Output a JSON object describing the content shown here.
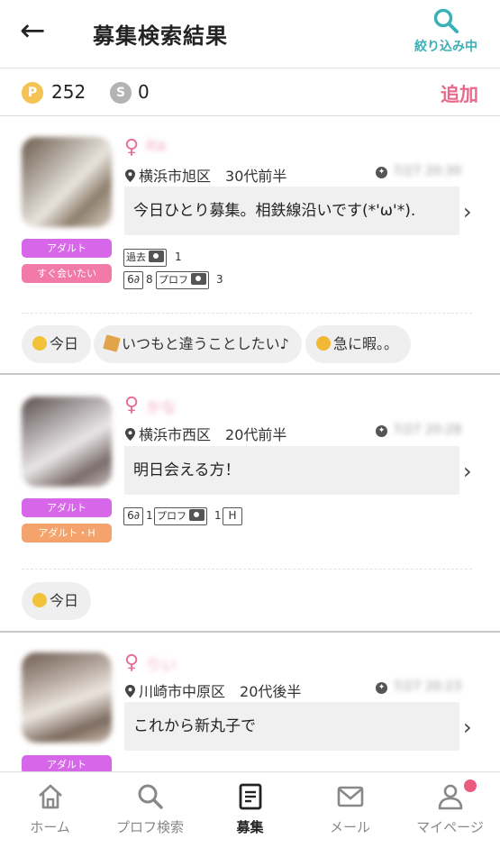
{
  "header": {
    "back_icon": "←",
    "title": "募集検索結果",
    "filter_label": "絞り込み中"
  },
  "points": {
    "p_icon": "P",
    "p_value": "252",
    "s_icon": "S",
    "s_value": "0",
    "add_label": "追加"
  },
  "cards": [
    {
      "tags": [
        "アダルト",
        "すぐ会いたい"
      ],
      "gender_icon": "♀",
      "nickname": "Ita",
      "location": "横浜市旭区",
      "age": "30代前半",
      "time": "7/27 20:30",
      "message": "今日ひとり募集。相鉄線沿いです(*'ω'*).",
      "badges": {
        "past": "過去",
        "past_count": "1",
        "glasses_count": "8",
        "profile": "プロフ",
        "profile_count": "3"
      },
      "chips": [
        "今日",
        "いつもと違うことしたい♪",
        "急に暇。。"
      ]
    },
    {
      "tags": [
        "アダルト",
        "アダルト・H"
      ],
      "gender_icon": "♀",
      "nickname": "かな",
      "location": "横浜市西区",
      "age": "20代前半",
      "time": "7/27 20:28",
      "message": "明日会える方！",
      "badges": {
        "glasses_count": "1",
        "profile": "プロフ",
        "profile_count": "1",
        "h": "H"
      },
      "chips": [
        "今日"
      ]
    },
    {
      "tags": [
        "アダルト"
      ],
      "gender_icon": "♀",
      "nickname": "りい",
      "location": "川崎市中原区",
      "age": "20代後半",
      "time": "7/27 20:23",
      "message": "これから新丸子で"
    }
  ],
  "tabbar": [
    {
      "label": "ホーム",
      "icon": "home-icon"
    },
    {
      "label": "プロフ検索",
      "icon": "search-icon"
    },
    {
      "label": "募集",
      "icon": "list-icon"
    },
    {
      "label": "メール",
      "icon": "mail-icon"
    },
    {
      "label": "マイページ",
      "icon": "person-icon"
    }
  ],
  "colors": {
    "accent": "#3bb0b7",
    "pink": "#e8698b",
    "adult_tag": "#d667e8"
  }
}
